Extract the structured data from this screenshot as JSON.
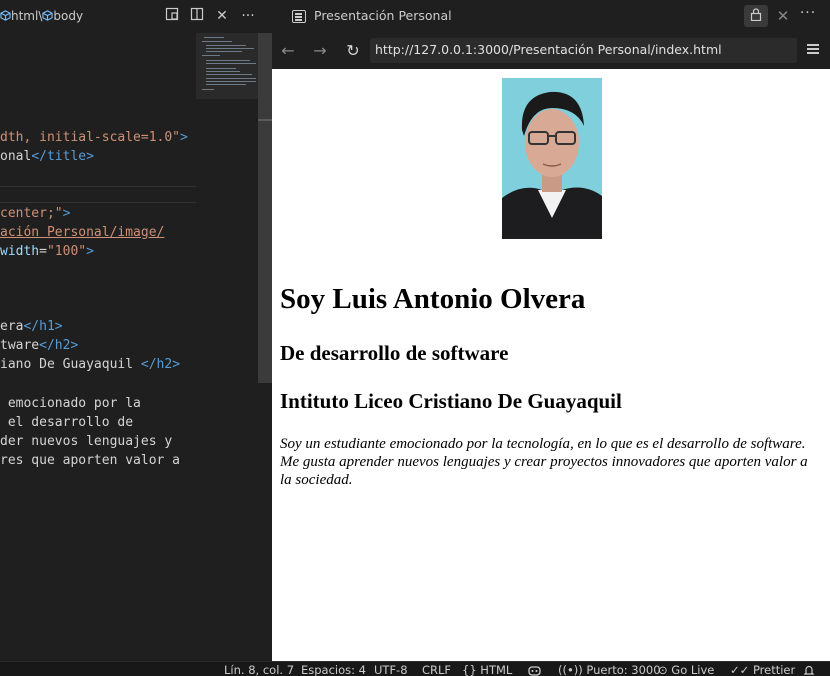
{
  "editor": {
    "breadcrumb": {
      "seg1": "html",
      "sep": "\\",
      "seg2": "body"
    },
    "code_lines": {
      "l1": {
        "a": "dth, initial-scale=1.0\"",
        "b": ">"
      },
      "l2": {
        "a": "onal",
        "b": "</title>"
      },
      "l3": {
        "a": "center;\"",
        "b": ">"
      },
      "l4": {
        "a": "ación Personal/image/"
      },
      "l5": {
        "a": "width",
        "b": "=",
        "c": "\"100\"",
        "d": ">"
      },
      "l6": {
        "a": "era",
        "b": "</h1>"
      },
      "l7": {
        "a": "tware",
        "b": "</h2>"
      },
      "l8": {
        "a": "iano De Guayaquil ",
        "b": "</h2>"
      },
      "l9": " emocionado por la",
      "l10": " el desarrollo de",
      "l11": "der nuevos lenguajes y",
      "l12": "res que aporten valor a"
    }
  },
  "browser": {
    "tab_title": "Presentación Personal",
    "url": "http://127.0.0.1:3000/Presentación Personal/index.html",
    "page": {
      "heading": "Soy Luis Antonio Olvera",
      "subheading1": "De desarrollo de software",
      "subheading2": "Intituto Liceo Cristiano De Guayaquil",
      "bio": "Soy un estudiante emocionado por la tecnología, en lo que es el desarrollo de software. Me gusta aprender nuevos lenguajes y crear proyectos innovadores que aporten valor a la sociedad."
    }
  },
  "statusbar": {
    "position": "Lín. 8, col. 7",
    "spaces": "Espacios: 4",
    "encoding": "UTF-8",
    "eol": "CRLF",
    "lang_braces": "{}",
    "language": "HTML",
    "port": "Puerto: 3000",
    "go_live": "Go Live",
    "prettier": "Prettier"
  },
  "colors": {
    "editor_bg": "#1f1f1f",
    "string": "#ce9178",
    "tag": "#569cd6",
    "attr": "#9cdcfe",
    "photo_bg": "#7fd0dc"
  }
}
